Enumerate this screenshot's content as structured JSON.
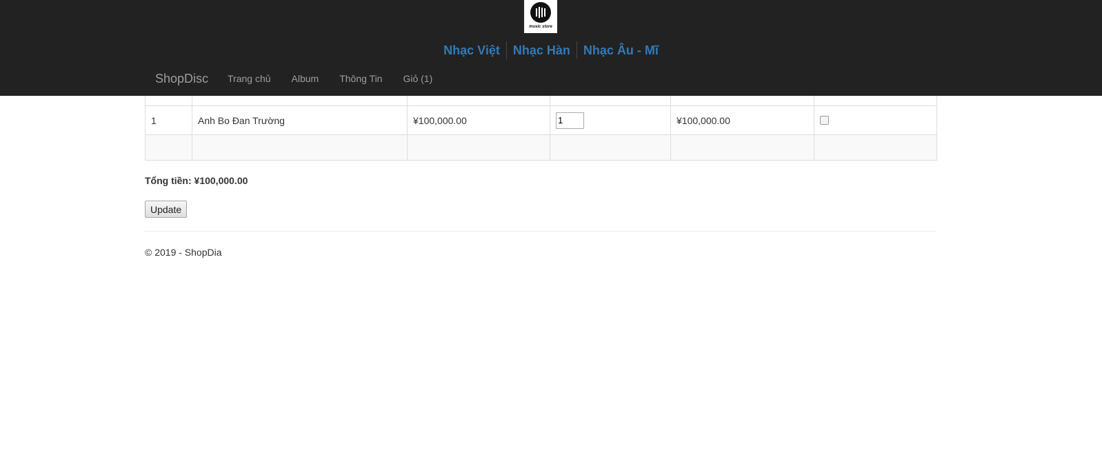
{
  "logo": {
    "caption": "music store"
  },
  "genres": [
    "Nhạc Việt",
    "Nhạc Hàn",
    "Nhạc Âu - Mĩ"
  ],
  "navbar": {
    "brand": "ShopDisc",
    "links": [
      "Trang chủ",
      "Album",
      "Thông Tin",
      "Giỏ (1)"
    ]
  },
  "cart": {
    "items": [
      {
        "no": "1",
        "name": "Anh Bo Đan Trường",
        "price": "¥100,000.00",
        "quantity": "1",
        "subtotal": "¥100,000.00",
        "remove_checked": false
      }
    ],
    "total_label": "Tổng tiền: ¥100,000.00",
    "update_label": "Update"
  },
  "footer": {
    "text": "© 2019 - ShopDia"
  },
  "colors": {
    "header_bg": "#222222",
    "genre_link": "#337ab7",
    "nav_text": "#9d9d9d"
  }
}
